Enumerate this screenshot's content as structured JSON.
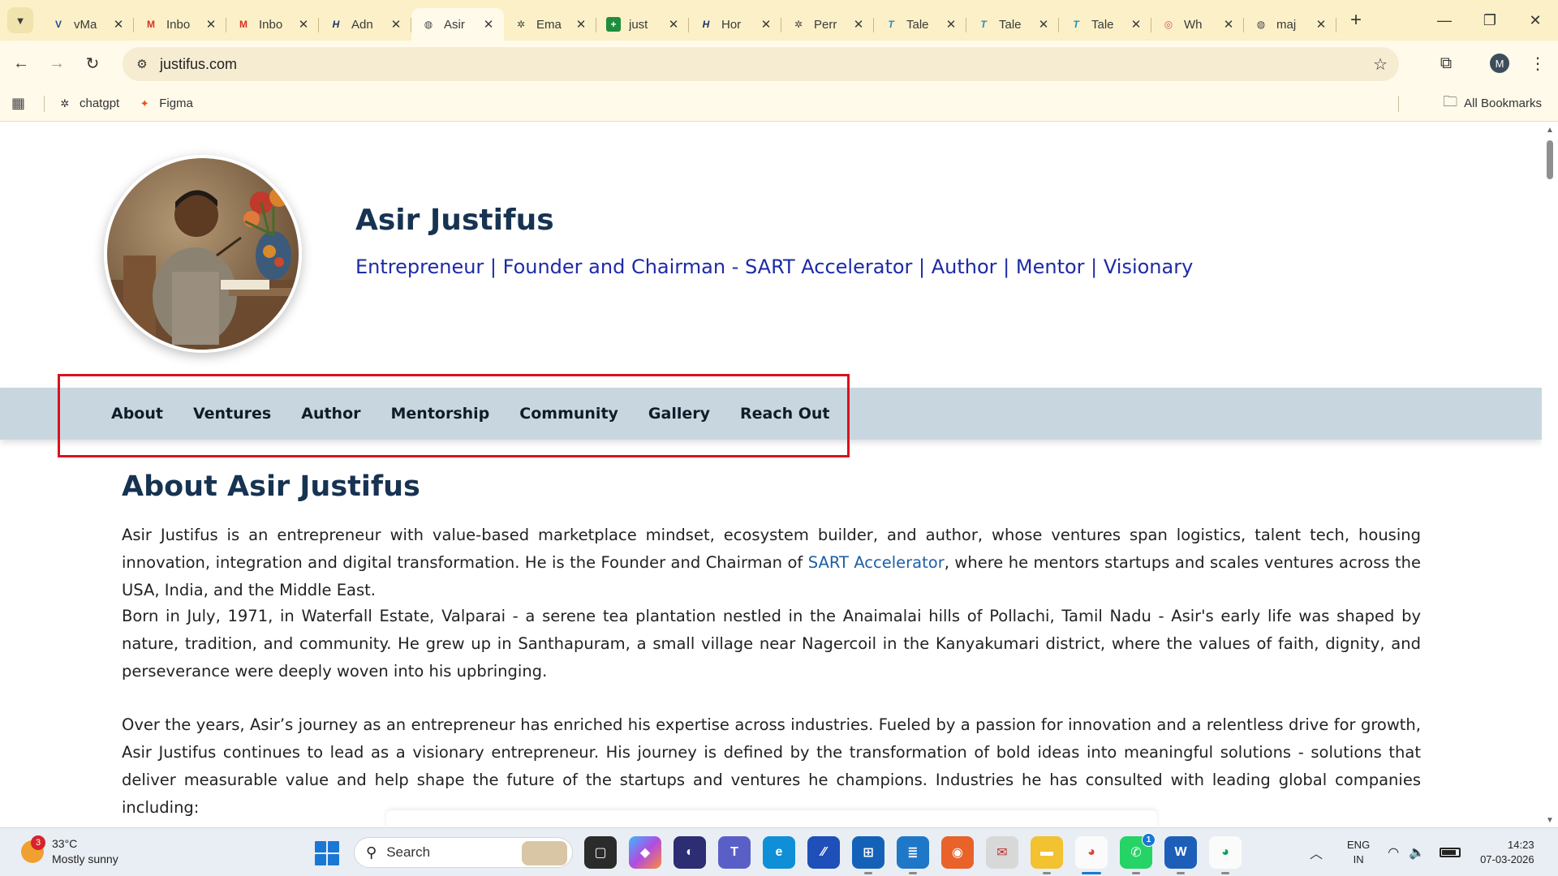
{
  "browser": {
    "tabs": [
      {
        "label": "vMa",
        "icon": "vmail-icon",
        "active": false
      },
      {
        "label": "Inbo",
        "icon": "gmail-icon",
        "active": false
      },
      {
        "label": "Inbo",
        "icon": "gmail-icon",
        "active": false
      },
      {
        "label": "Adn",
        "icon": "admin-icon",
        "active": false
      },
      {
        "label": "Asir",
        "icon": "globe-icon",
        "active": true
      },
      {
        "label": "Ema",
        "icon": "chatgpt-icon",
        "active": false
      },
      {
        "label": "just",
        "icon": "sheets-icon",
        "active": false
      },
      {
        "label": "Hor",
        "icon": "admin-icon",
        "active": false
      },
      {
        "label": "Perr",
        "icon": "chatgpt-icon",
        "active": false
      },
      {
        "label": "Tale",
        "icon": "talent-icon",
        "active": false
      },
      {
        "label": "Tale",
        "icon": "talent-icon",
        "active": false
      },
      {
        "label": "Tale",
        "icon": "talent-icon",
        "active": false
      },
      {
        "label": "Wh",
        "icon": "whatsapp-web-icon",
        "active": false
      },
      {
        "label": "maj",
        "icon": "globe-icon",
        "active": false
      }
    ],
    "url": "justifus.com",
    "profile_initial": "M",
    "bookmarks": [
      {
        "label": "chatgpt",
        "icon": "chatgpt-icon"
      },
      {
        "label": "Figma",
        "icon": "figma-icon"
      }
    ],
    "all_bookmarks_label": "All Bookmarks"
  },
  "profile": {
    "name": "Asir Justifus",
    "tagline": "Entrepreneur | Founder and Chairman - SART Accelerator | Author | Mentor | Visionary"
  },
  "nav": {
    "items": [
      "About",
      "Ventures",
      "Author",
      "Mentorship",
      "Community",
      "Gallery",
      "Reach Out"
    ]
  },
  "about": {
    "title": "About Asir Justifus",
    "p1_before": "Asir Justifus is an entrepreneur with value-based marketplace mindset, ecosystem builder, and author, whose ventures span logistics, talent tech, housing innovation, integration and digital transformation. He is the Founder and Chairman of ",
    "p1_link": "SART Accelerator",
    "p1_after": ", where he mentors startups and scales ventures across the USA, India, and the Middle East.",
    "p2": "Born in July, 1971, in Waterfall Estate, Valparai - a serene tea plantation nestled in the Anaimalai hills of Pollachi, Tamil Nadu - Asir's early life was shaped by nature, tradition, and community. He grew up in Santhapuram, a small village near Nagercoil in the Kanyakumari district, where the values of faith, dignity, and perseverance were deeply woven into his upbringing.",
    "p3": "Over the years, Asir’s journey as an entrepreneur has enriched his expertise across industries. Fueled by a passion for innovation and a relentless drive for growth, Asir Justifus continues to lead as a visionary entrepreneur. His journey is defined by the transformation of bold ideas into meaningful solutions - solutions that deliver measurable value and help shape the future of the startups and ventures he champions. Industries he has consulted with leading global companies including:"
  },
  "taskbar": {
    "weather_temp": "33°C",
    "weather_desc": "Mostly sunny",
    "weather_badge": "3",
    "search_placeholder": "Search",
    "lang_top": "ENG",
    "lang_bottom": "IN",
    "time": "14:23",
    "date": "07-03-2026",
    "teams_badge": "1"
  },
  "colors": {
    "tab_strip": "#fbf0c7",
    "toolbar": "#fffaea",
    "heading": "#173352",
    "tagline": "#1e2aa8",
    "nav_band": "#c8d7df",
    "link": "#1e5fa8",
    "highlight": "#d9121f"
  }
}
